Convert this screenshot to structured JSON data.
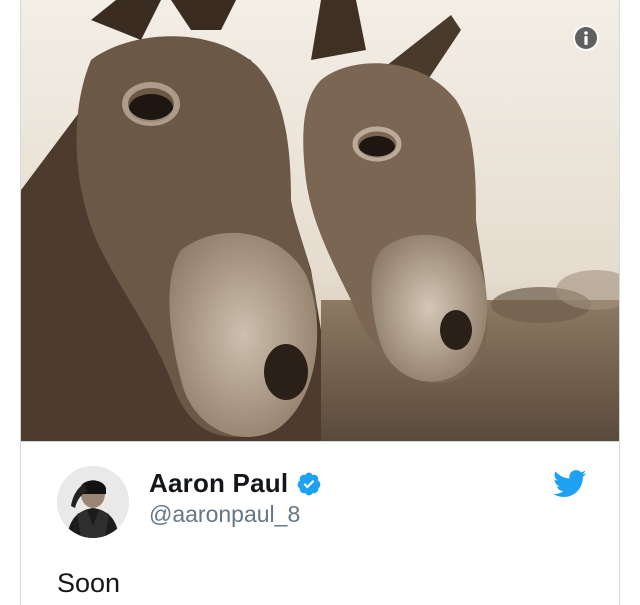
{
  "tweet": {
    "author_name": "Aaron Paul",
    "handle": "@aaronpaul_8",
    "text": "Soon",
    "verified": true
  },
  "media": {
    "info_icon": "info-icon"
  },
  "icons": {
    "verified": "verified-badge-icon",
    "platform": "twitter-bird-icon"
  },
  "colors": {
    "brand_blue": "#1da1f2",
    "name_text": "#14171a",
    "handle_text": "#657786",
    "border": "#cfd9de"
  }
}
